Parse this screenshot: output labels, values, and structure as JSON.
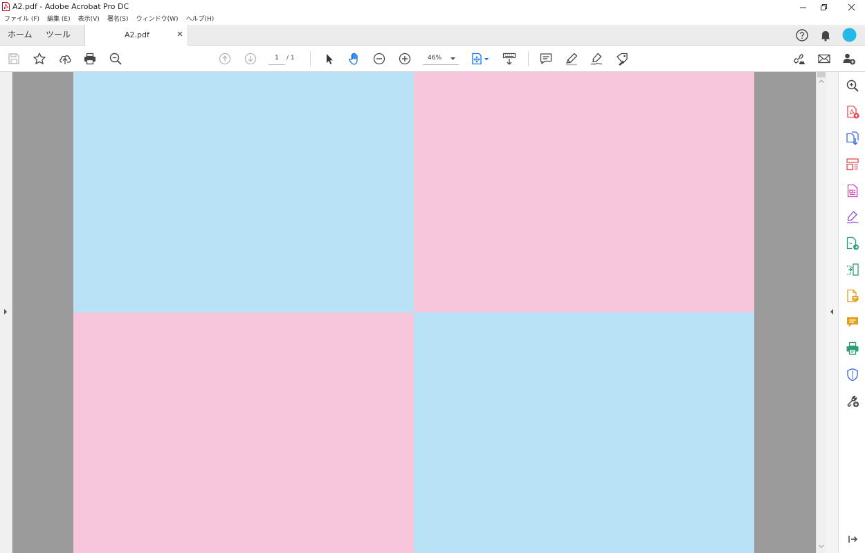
{
  "window": {
    "title": "A2.pdf - Adobe Acrobat Pro DC",
    "controls": [
      "minimize-icon",
      "restore-icon",
      "close-icon"
    ]
  },
  "menu": {
    "items": [
      "ファイル (F)",
      "編集 (E)",
      "表示(V)",
      "署名(S)",
      "ウィンドウ(W)",
      "ヘルプ(H)"
    ]
  },
  "tabs": {
    "home": "ホーム",
    "tools": "ツール",
    "document": "A2.pdf"
  },
  "toolbar": {
    "page_current": "1",
    "page_total": "/ 1",
    "zoom": "46%"
  },
  "document": {
    "colors": {
      "blue": "#b9e2f6",
      "pink": "#f7c6dd"
    }
  },
  "colors": {
    "accent": "#1473e6",
    "avatar": "#27b9e6",
    "viewer_background": "#9b9b9b"
  },
  "tools_pane": {
    "icons": [
      "search-zoom-icon",
      "create-pdf-icon",
      "export-pdf-icon",
      "organize-pages-icon",
      "edit-pdf-icon",
      "fill-sign-icon",
      "send-for-signature-icon",
      "combine-files-icon",
      "scan-icon",
      "comment-icon",
      "print-production-icon",
      "protect-icon",
      "more-tools-icon",
      "collapse-pane-icon"
    ]
  }
}
